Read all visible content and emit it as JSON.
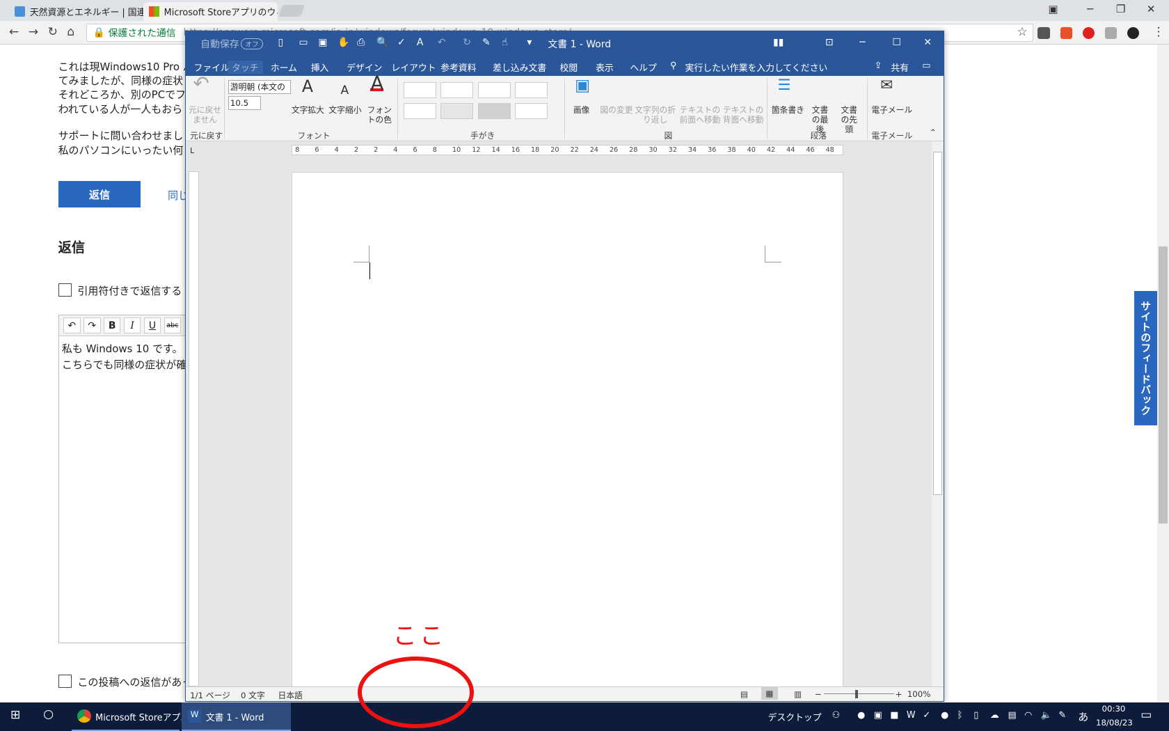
{
  "browser": {
    "tabs": [
      {
        "label": "天然資源とエネルギー | 国連"
      },
      {
        "label": "Microsoft Storeアプリのウィ"
      }
    ],
    "omnibox": {
      "secure_label": "保護された通信",
      "url": "https://answers.microsoft.com/ja-jp/windows/forum/windows_10-windows_store/..."
    }
  },
  "page": {
    "body_lines": [
      "これは現Windows10 Pro バ",
      "てみましたが、同様の症状",
      "それどころか、別のPCでフ",
      "われている人が一人もおら",
      "サポートに問い合わせまし",
      "私のパソコンにいったい何"
    ],
    "reply_button": "返信",
    "same_question_link": "同じ",
    "reply_heading": "返信",
    "quote_checkbox_label": "引用符付きで返信する",
    "editor_toolbar": {
      "undo": "↶",
      "redo": "↷",
      "bold": "B",
      "italic": "I",
      "underline": "U",
      "strike": "abc"
    },
    "editor_lines": [
      "私も Windows 10 です。",
      "こちらでも同様の症状が確"
    ],
    "notify_checkbox_label": "この投稿への返信があっ",
    "feedback_tab": "サイトのフィードバック"
  },
  "word": {
    "autosave_label": "自動保存",
    "autosave_state": "オフ",
    "title": "文書 1 - Word",
    "menu": [
      "ファイル",
      "タッチ",
      "ホーム",
      "挿入",
      "デザイン",
      "レイアウト",
      "参考資料",
      "差し込み文書",
      "校閲",
      "表示",
      "ヘルプ"
    ],
    "tell_me": "実行したい作業を入力してください",
    "share": "共有",
    "ribbon": {
      "undo_label": "元に戻せません",
      "undo_group": "元に戻す",
      "font_name": "游明朝 (本文の",
      "font_size": "10.5",
      "grow_font": "文字拡大",
      "shrink_font": "文字縮小",
      "font_color": "フォントの色",
      "font_group": "フォント",
      "ink_group": "手がき",
      "picture": "画像",
      "change_picture": "図の変更",
      "wrap_text": "文字列の折り返し",
      "bring_front": "テキストの前面へ移動",
      "send_back": "テキストの背面へ移動",
      "figure_group": "図",
      "bullets": "箇条書き",
      "doc_end": "文書の最後",
      "doc_start": "文書の先頭",
      "paragraph_group": "段落",
      "email": "電子メール",
      "email_group": "電子メール"
    },
    "ruler_ticks": [
      "8",
      "6",
      "4",
      "2",
      "2",
      "4",
      "6",
      "8",
      "10",
      "12",
      "14",
      "16",
      "18",
      "20",
      "22",
      "24",
      "26",
      "28",
      "30",
      "32",
      "34",
      "36",
      "38",
      "40",
      "42",
      "44",
      "46",
      "48"
    ],
    "status": {
      "page": "1/1 ページ",
      "words": "0 文字",
      "language": "日本語",
      "zoom": "100%"
    }
  },
  "annotation": {
    "text": "ここ",
    "color": "#e11111"
  },
  "taskbar": {
    "chrome_item": "Microsoft Storeアプ...",
    "word_item": "文書 1 - Word",
    "desktop": "デスクトップ",
    "ime": "あ",
    "time": "00:30",
    "date": "18/08/23"
  }
}
